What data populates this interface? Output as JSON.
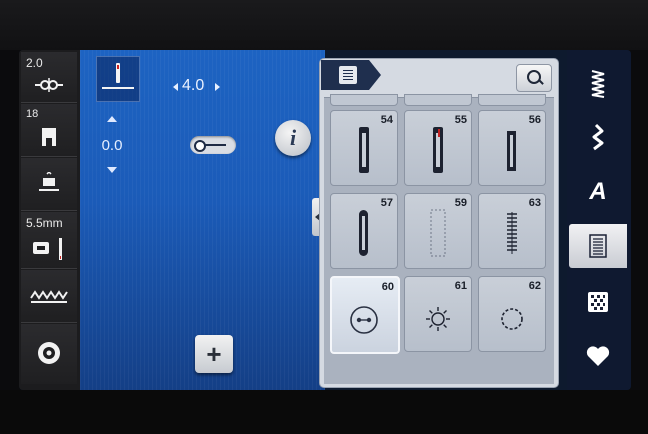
{
  "left_strip": {
    "stitch_length": "2.0",
    "presser_foot": "18",
    "needle_size": "5.5mm"
  },
  "center": {
    "needle_position": "0.0",
    "stitch_width": "4.0",
    "info_label": "i",
    "add_label": "+"
  },
  "stitch_panel": {
    "cells": [
      {
        "num": "54",
        "art": "buttonhole-solid"
      },
      {
        "num": "55",
        "art": "buttonhole-red-bar"
      },
      {
        "num": "56",
        "art": "buttonhole-keyhole"
      },
      {
        "num": "57",
        "art": "buttonhole-rounded"
      },
      {
        "num": "59",
        "art": "buttonhole-outline"
      },
      {
        "num": "63",
        "art": "buttonhole-zigzag"
      },
      {
        "num": "60",
        "art": "button-sew-on",
        "selected": true
      },
      {
        "num": "61",
        "art": "eyelet-star"
      },
      {
        "num": "62",
        "art": "eyelet-circle"
      }
    ]
  },
  "right_strip": {
    "items": [
      {
        "icon": "zigzag-stitch-icon"
      },
      {
        "icon": "decorative-stitch-icon"
      },
      {
        "icon": "alphabet-icon",
        "label": "A"
      },
      {
        "icon": "buttonhole-category-icon",
        "active": true
      },
      {
        "icon": "quilt-pattern-icon"
      },
      {
        "icon": "favorites-heart-icon"
      }
    ]
  },
  "colors": {
    "screen_blue": "#1d63c2",
    "panel_gray": "#d5dae2",
    "accent_red": "#c22222"
  }
}
